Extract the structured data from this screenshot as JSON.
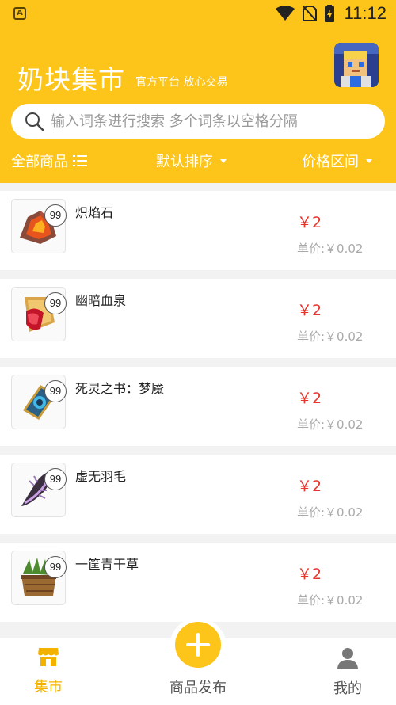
{
  "status_bar": {
    "time": "11:12",
    "app_badge": "A"
  },
  "header": {
    "title": "奶块集市",
    "subtitle": "官方平台 放心交易"
  },
  "search": {
    "placeholder": "输入词条进行搜索 多个词条以空格分隔",
    "value": ""
  },
  "filters": {
    "all_goods": "全部商品",
    "sort": "默认排序",
    "price_range": "价格区间"
  },
  "items": [
    {
      "name": "炽焰石",
      "count": "99",
      "price": "￥2",
      "unit_price": "单价:￥0.02",
      "icon": "flame-stone-icon"
    },
    {
      "name": "幽暗血泉",
      "count": "99",
      "price": "￥2",
      "unit_price": "单价:￥0.02",
      "icon": "blood-potion-icon"
    },
    {
      "name": "死灵之书：梦魇",
      "count": "99",
      "price": "￥2",
      "unit_price": "单价:￥0.02",
      "icon": "necro-book-icon"
    },
    {
      "name": "虚无羽毛",
      "count": "99",
      "price": "￥2",
      "unit_price": "单价:￥0.02",
      "icon": "void-feather-icon"
    },
    {
      "name": "一筐青干草",
      "count": "99",
      "price": "￥2",
      "unit_price": "单价:￥0.02",
      "icon": "hay-basket-icon"
    }
  ],
  "tabbar": {
    "market": "集市",
    "publish": "商品发布",
    "mine": "我的"
  },
  "colors": {
    "brand": "#fdc41a",
    "price": "#e8352e"
  }
}
